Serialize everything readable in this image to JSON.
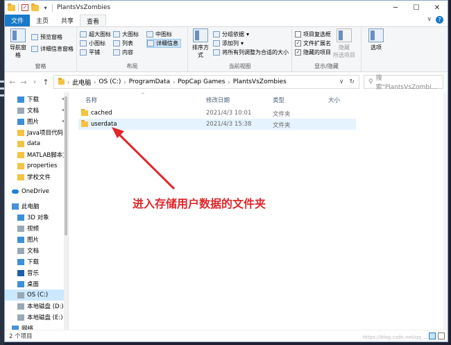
{
  "window": {
    "title": "PlantsVsZombies"
  },
  "tabs": [
    {
      "label": "文件"
    },
    {
      "label": "主页"
    },
    {
      "label": "共享"
    },
    {
      "label": "查看"
    }
  ],
  "ribbon": {
    "pane": {
      "nav_pane": "导航窗格",
      "preview": "预览窗格",
      "details": "详细信息窗格",
      "group": "窗格"
    },
    "layout": {
      "items": [
        "超大图标",
        "大图标",
        "中图标",
        "小图标",
        "列表",
        "详细信息",
        "平铺",
        "内容"
      ],
      "group": "布局"
    },
    "current_view": {
      "sort": "排序方式",
      "group_by": "分组依据",
      "add_col": "添加列",
      "fit_cols": "将所有列调整为合适的大小",
      "group": "当前视图"
    },
    "show_hide": {
      "item_checkbox": "项目复选框",
      "ext": "文件扩展名",
      "hidden": "隐藏的项目",
      "hide_sel": "隐藏",
      "hide_sel2": "所选项目",
      "group": "显示/隐藏"
    },
    "options": "选项"
  },
  "address": {
    "crumbs": [
      "此电脑",
      "OS (C:)",
      "ProgramData",
      "PopCap Games",
      "PlantsVsZombies"
    ],
    "search_placeholder": "搜索\"PlantsVsZombi..."
  },
  "nav_pane": {
    "quick": [
      {
        "label": "下载",
        "icon": "download-icon"
      },
      {
        "label": "文档",
        "icon": "documents-icon"
      },
      {
        "label": "图片",
        "icon": "pictures-icon"
      },
      {
        "label": "Java项目代码",
        "icon": "folder-icon"
      },
      {
        "label": "data",
        "icon": "folder-icon"
      },
      {
        "label": "MATLAB脚本文",
        "icon": "folder-icon"
      },
      {
        "label": "properties",
        "icon": "folder-icon"
      },
      {
        "label": "学校文件",
        "icon": "folder-icon"
      }
    ],
    "onedrive": "OneDrive",
    "this_pc": "此电脑",
    "pc_items": [
      {
        "label": "3D 对象",
        "icon": "3d-objects-icon"
      },
      {
        "label": "视频",
        "icon": "videos-icon"
      },
      {
        "label": "图片",
        "icon": "pictures-icon"
      },
      {
        "label": "文档",
        "icon": "documents-icon"
      },
      {
        "label": "下载",
        "icon": "download-icon"
      },
      {
        "label": "音乐",
        "icon": "music-icon"
      },
      {
        "label": "桌面",
        "icon": "desktop-icon"
      },
      {
        "label": "OS (C:)",
        "icon": "drive-icon"
      },
      {
        "label": "本地磁盘 (D:)",
        "icon": "drive-icon"
      },
      {
        "label": "本地磁盘 (E:)",
        "icon": "drive-icon"
      }
    ],
    "network": "网络"
  },
  "columns": {
    "name": "名称",
    "modified": "修改日期",
    "type": "类型",
    "size": "大小"
  },
  "files": [
    {
      "name": "cached",
      "modified": "2021/4/3 10:01",
      "type": "文件夹"
    },
    {
      "name": "userdata",
      "modified": "2021/4/3 15:38",
      "type": "文件夹"
    }
  ],
  "annotation": "进入存储用户数据的文件夹",
  "status": {
    "count": "2 个项目"
  },
  "watermark": "https://blog.csdn.net/qq_...",
  "colors": {
    "accent": "#1979ca",
    "annotation": "#e0262b",
    "selection": "#cce8ff"
  }
}
